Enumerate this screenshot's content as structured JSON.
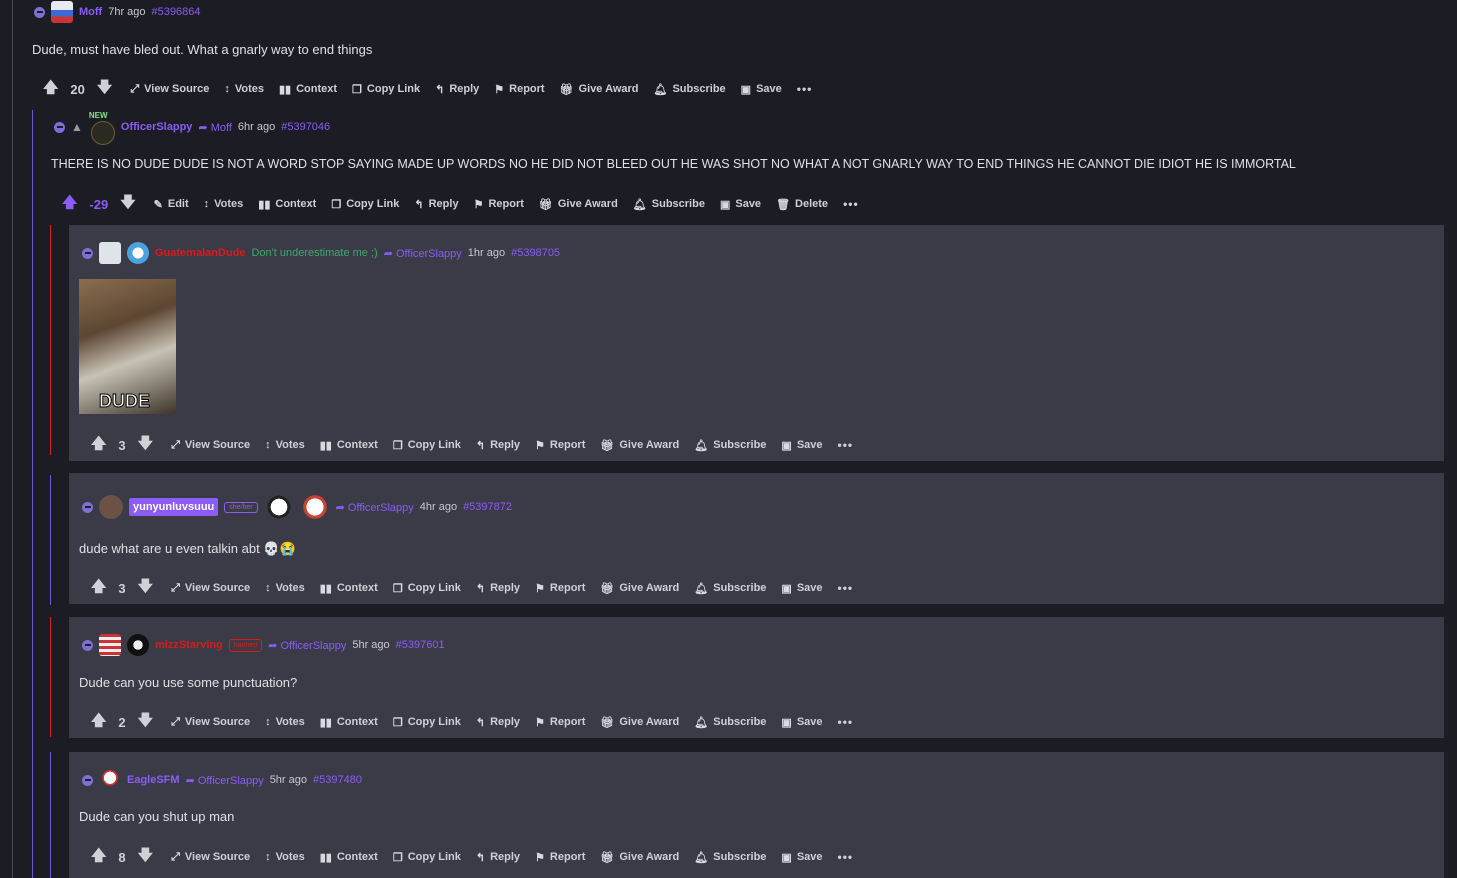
{
  "common": {
    "view_source": "View Source",
    "votes": "Votes",
    "context": "Context",
    "copy_link": "Copy Link",
    "reply": "Reply",
    "report": "Report",
    "give_award": "Give Award",
    "subscribe": "Subscribe",
    "save": "Save",
    "edit": "Edit",
    "delete": "Delete",
    "more": "•••"
  },
  "comments": [
    {
      "user": "Moff",
      "time": "7hr ago",
      "id": "#5396864",
      "body": "Dude, must have bled out. What a gnarly way to end things",
      "score": "20"
    },
    {
      "user": "OfficerSlappy",
      "reply_to": "Moff",
      "time": "6hr ago",
      "id": "#5397046",
      "body": "THERE IS NO DUDE DUDE IS NOT A WORD STOP SAYING MADE UP WORDS NO HE DID NOT BLEED OUT HE WAS SHOT NO WHAT A NOT GNARLY WAY TO END THINGS HE CANNOT DIE IDIOT HE IS IMMORTAL",
      "score": "-29",
      "avatar_tag": "NEW"
    },
    {
      "user": "GuatemalanDude",
      "flair": "Don't underestimate me ;)",
      "reply_to": "OfficerSlappy",
      "time": "1hr ago",
      "id": "#5398705",
      "image_caption": "DUDE",
      "score": "3"
    },
    {
      "user": "yunyunluvsuuu",
      "pronouns": "she/her",
      "reply_to": "OfficerSlappy",
      "time": "4hr ago",
      "id": "#5397872",
      "body": "dude what are u even talkin abt 💀😭",
      "score": "3"
    },
    {
      "user": "mizzStarving",
      "tag": "banned",
      "reply_to": "OfficerSlappy",
      "time": "5hr ago",
      "id": "#5397601",
      "body": "Dude can you use some punctuation?",
      "score": "2"
    },
    {
      "user": "EagleSFM",
      "reply_to": "OfficerSlappy",
      "time": "5hr ago",
      "id": "#5397480",
      "body": "Dude can you shut up man",
      "score": "8"
    }
  ],
  "colors": {
    "accent": "#8b5cf6",
    "card": "#3a3b47",
    "background": "#1c1d24",
    "red_name": "#d81b1b",
    "flair_green": "#3ea86b"
  }
}
